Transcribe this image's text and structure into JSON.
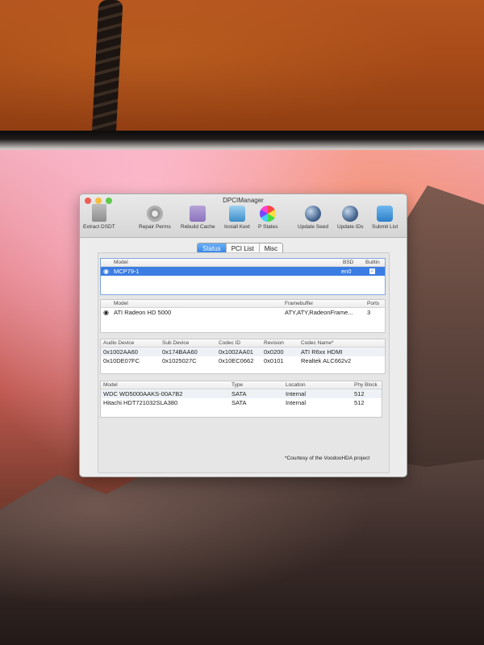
{
  "window": {
    "title": "DPCIManager"
  },
  "toolbar": {
    "items": [
      {
        "label": "Extract DSDT",
        "icon": "document-icon"
      },
      {
        "label": "Repair Perms",
        "icon": "gear-icon"
      },
      {
        "label": "Rebuild Cache",
        "icon": "folder-icon"
      },
      {
        "label": "Install Kext",
        "icon": "kext-icon"
      },
      {
        "label": "P States",
        "icon": "color-wheel-icon"
      },
      {
        "label": "Update Seed",
        "icon": "globe-icon"
      },
      {
        "label": "Update IDs",
        "icon": "globe-icon"
      },
      {
        "label": "Submit List",
        "icon": "cloud-icon"
      }
    ]
  },
  "tabs": [
    {
      "label": "Status",
      "selected": true
    },
    {
      "label": "PCI List",
      "selected": false
    },
    {
      "label": "Misc",
      "selected": false
    }
  ],
  "network": {
    "headers": [
      "Model",
      "BSD",
      "Builtin"
    ],
    "rows": [
      {
        "model": "MCP79-1",
        "bsd": "en0",
        "builtin": true
      }
    ]
  },
  "graphics": {
    "headers": [
      "Model",
      "Framebuffer",
      "Ports"
    ],
    "rows": [
      {
        "model": "ATI Radeon HD 5000",
        "framebuffer": "ATY,ATY,RadeonFrame...",
        "ports": "3"
      }
    ]
  },
  "audio": {
    "headers": [
      "Audio Device",
      "Sub Device",
      "Codec ID",
      "Revision",
      "Codec Name*"
    ],
    "rows": [
      [
        "0x1002AA60",
        "0x174BAA60",
        "0x1002AA01",
        "0x0200",
        "ATI R6xx HDMI"
      ],
      [
        "0x10DE07FC",
        "0x1025027C",
        "0x10EC0662",
        "0x0101",
        "Realtek ALC662v2"
      ]
    ]
  },
  "disks": {
    "headers": [
      "Model",
      "Type",
      "Location",
      "Phy Block"
    ],
    "rows": [
      [
        "WDC WD5000AAKS-00A7B2",
        "SATA",
        "Internal",
        "512"
      ],
      [
        "Hitachi HDT721032SLA380",
        "SATA",
        "Internal",
        "512"
      ]
    ]
  },
  "footnote": "*Courtesy of the VoodooHDA project",
  "colors": {
    "selection": "#3b7de3",
    "close": "#ef5f57",
    "minimize": "#f5be40",
    "zoom": "#5fc94b"
  }
}
